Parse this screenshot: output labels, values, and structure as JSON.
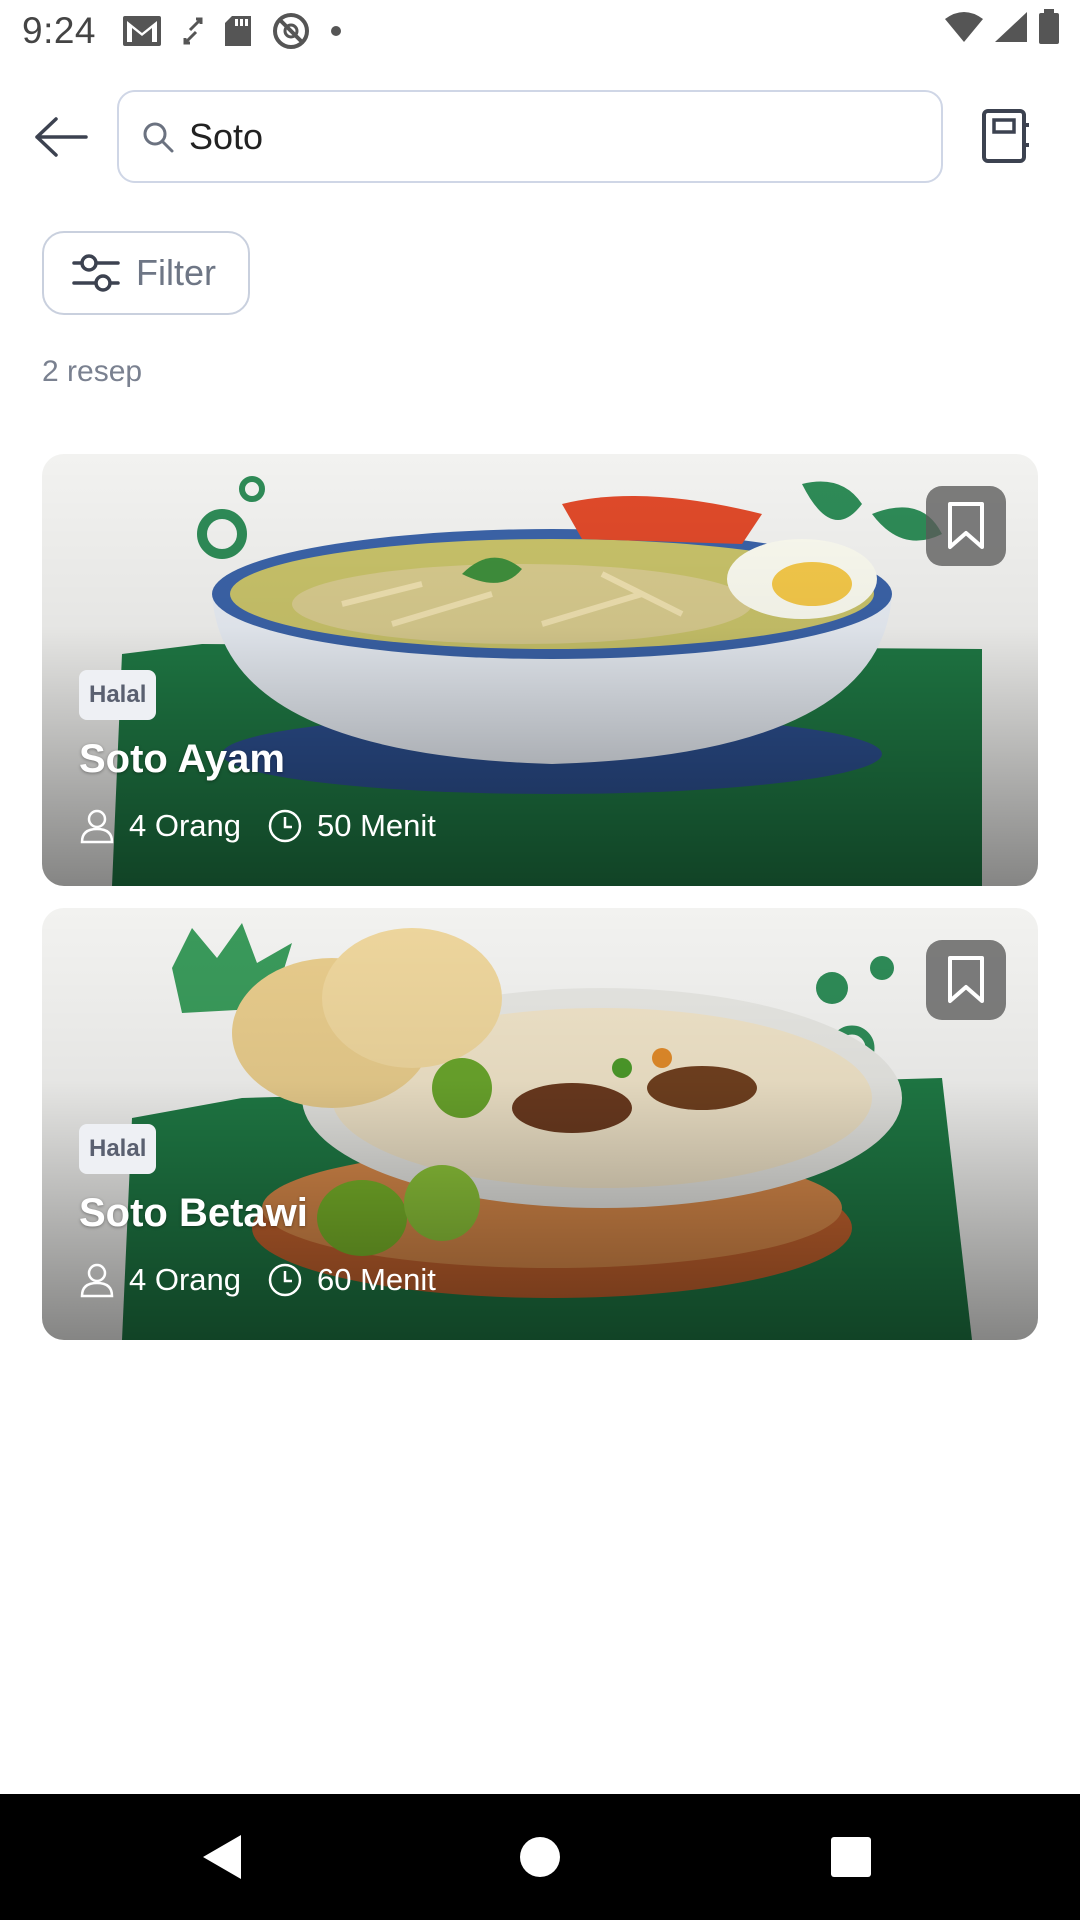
{
  "status_bar": {
    "time": "9:24",
    "icons_left": [
      "gmail-icon",
      "sync-icon",
      "sd-card-icon",
      "do-not-disturb-icon",
      "dot-icon"
    ],
    "icons_right": [
      "wifi-icon",
      "signal-icon",
      "battery-icon"
    ]
  },
  "app_bar": {
    "back_icon": "arrow-left-icon",
    "search": {
      "value": "Soto",
      "placeholder": ""
    },
    "bookmark_list_icon": "book-icon"
  },
  "filter": {
    "label": "Filter",
    "icon": "sliders-icon"
  },
  "results": {
    "count_text": "2 resep"
  },
  "recipes": [
    {
      "badge": "Halal",
      "title": "Soto Ayam",
      "servings": "4 Orang",
      "duration": "50 Menit",
      "bookmark_icon": "bookmark-icon"
    },
    {
      "badge": "Halal",
      "title": "Soto Betawi",
      "servings": "4 Orang",
      "duration": "60 Menit",
      "bookmark_icon": "bookmark-icon"
    }
  ],
  "nav_bar": {
    "icons": [
      "nav-back-icon",
      "nav-home-icon",
      "nav-recents-icon"
    ]
  },
  "colors": {
    "search_border": "#cfd6e6",
    "muted_text": "#7a8190",
    "card_green": "#1f7a45",
    "nav_bar": "#000000"
  }
}
